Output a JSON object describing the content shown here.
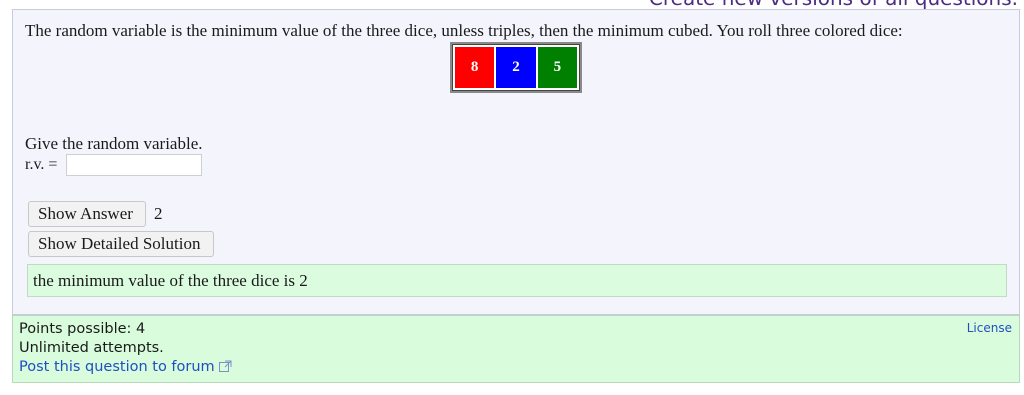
{
  "page": {
    "top_link": "Create new versions of all questions."
  },
  "question": {
    "text": "The random variable is the minimum value of the three dice, unless triples, then the minimum cubed. You roll three colored dice:",
    "dice": [
      {
        "value": "8",
        "color": "#ff0000"
      },
      {
        "value": "2",
        "color": "#0000ff"
      },
      {
        "value": "5",
        "color": "#008000"
      }
    ],
    "prompt": "Give the random variable.",
    "input_label": "r.v. =",
    "input_value": "",
    "show_answer_label": "Show Answer",
    "answer_value": "2",
    "show_solution_label": "Show Detailed Solution",
    "solution_text": "the minimum value of the three dice is 2"
  },
  "footer": {
    "points": "Points possible: 4",
    "attempts": "Unlimited attempts.",
    "forum_link": "Post this question to forum",
    "license": "License"
  },
  "colors": {
    "question_bg": "#f4f4fd",
    "solution_bg": "#dcfce0",
    "footer_bg": "#d8fcdc",
    "link": "#1f4fc4"
  }
}
